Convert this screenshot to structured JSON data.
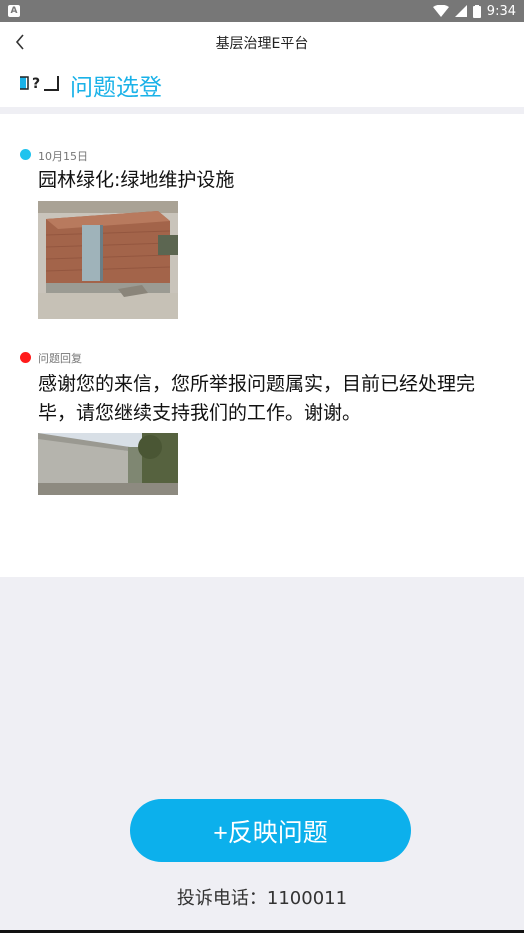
{
  "status_bar": {
    "time": "9:34",
    "notification_icon": "a-notification-icon",
    "battery_label": "B"
  },
  "header": {
    "title": "基层治理E平台",
    "back_icon": "back-arrow-icon"
  },
  "section": {
    "icon": "question-screen-icon",
    "title": "问题选登"
  },
  "issue": {
    "date": "10月15日",
    "title": "园林绿化:绿地维护设施",
    "dot_color": "#1fc3ee"
  },
  "reply": {
    "label": "问题回复",
    "text": "感谢您的来信，您所举报问题属实，目前已经处理完毕，请您继续支持我们的工作。谢谢。",
    "dot_color": "#ff1a1a"
  },
  "footer": {
    "report_button": "+反映问题",
    "phone_label": "投诉电话：1100011"
  },
  "colors": {
    "accent": "#1ab2e8",
    "button": "#0cb0ec"
  }
}
